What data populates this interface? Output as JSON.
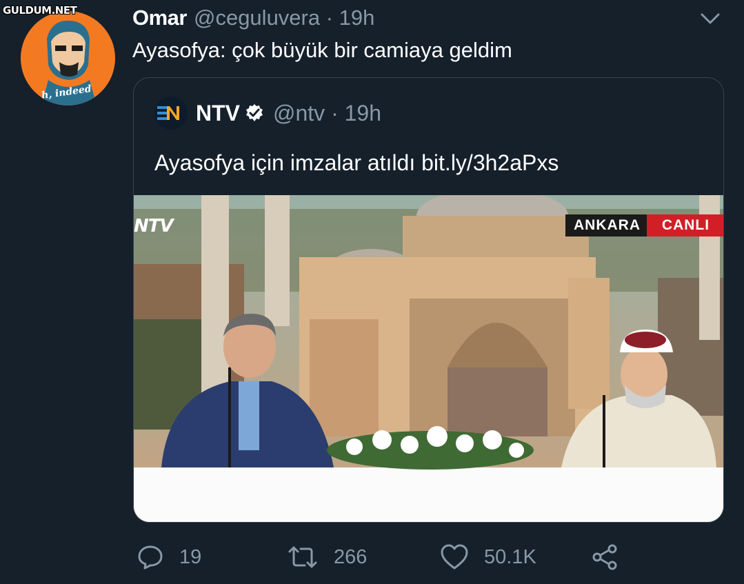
{
  "watermark": "GULDUM.NET",
  "tweet": {
    "author_name": "Omar",
    "author_handle": "@ceguluvera · 19h",
    "text": "Ayasofya: çok büyük bir camiaya geldim",
    "avatar_caption": "h, indeed"
  },
  "quote": {
    "author_name": "NTV",
    "author_handle": "@ntv · 19h",
    "text": "Ayasofya için imzalar atıldı bit.ly/3h2aPxs",
    "media": {
      "channel_logo": "NTV",
      "location_badge": "ANKARA",
      "live_badge": "CANLI"
    }
  },
  "actions": {
    "reply_count": "19",
    "retweet_count": "266",
    "like_count": "50.1K"
  },
  "icons": [
    "chevron-down-icon",
    "verified-icon",
    "reply-icon",
    "retweet-icon",
    "like-icon",
    "share-icon"
  ],
  "colors": {
    "background": "#15202b",
    "secondary_text": "#8899a6",
    "border": "#38444d",
    "avatar_orange": "#f47a22",
    "live_red": "#d21f26"
  }
}
